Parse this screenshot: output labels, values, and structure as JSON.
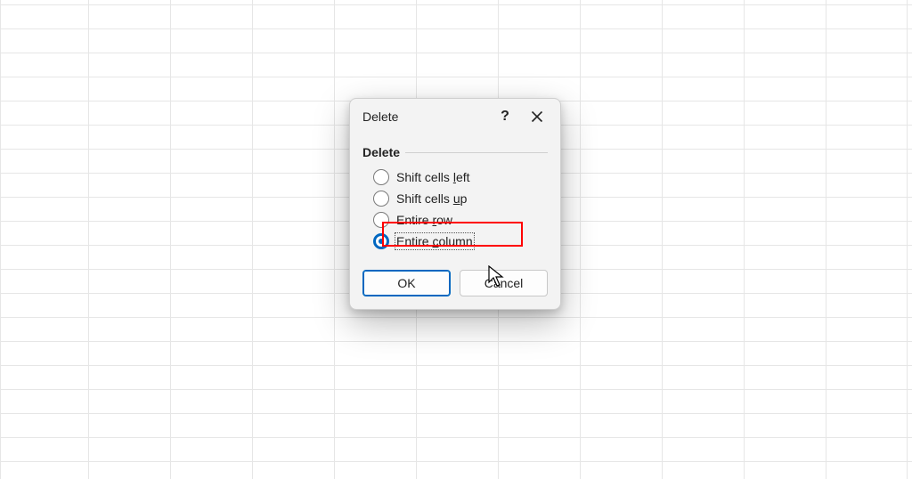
{
  "dialog": {
    "title": "Delete",
    "help_tooltip": "?",
    "close_tooltip": "Close",
    "group_label": "Delete",
    "options": {
      "shift_left": {
        "before": "Shift cells ",
        "mn": "l",
        "after": "eft",
        "selected": false
      },
      "shift_up": {
        "before": "Shift cells ",
        "mn": "u",
        "after": "p",
        "selected": false
      },
      "entire_row": {
        "before": "Entire ",
        "mn": "r",
        "after": "ow",
        "selected": false
      },
      "entire_column": {
        "before": "Entire ",
        "mn": "c",
        "after": "olumn",
        "selected": true
      }
    },
    "ok_label": "OK",
    "cancel_label": "Cancel"
  }
}
